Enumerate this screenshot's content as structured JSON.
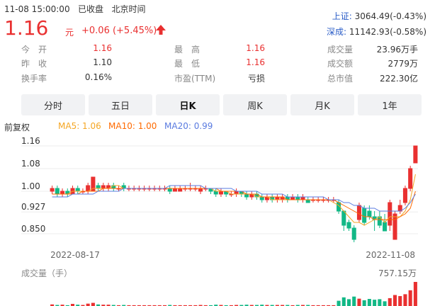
{
  "header": {
    "datetime": "11-08 15:00:00",
    "status": "已收盘",
    "timezone": "北京时间"
  },
  "quote": {
    "price": "1.16",
    "unit": "元",
    "change": "+0.06 (+5.45%)",
    "direction": "up"
  },
  "indices": [
    {
      "name": "上证:",
      "value": "3064.49(-0.43%)"
    },
    {
      "name": "深成:",
      "value": "11142.93(-0.58%)"
    }
  ],
  "stats": [
    {
      "label": "今　开",
      "value": "1.16",
      "red": true
    },
    {
      "label": "最　高",
      "value": "1.16",
      "red": true
    },
    {
      "label": "成交量",
      "value": "23.96万手",
      "red": false
    },
    {
      "label": "昨　收",
      "value": "1.10",
      "red": false
    },
    {
      "label": "最　低",
      "value": "1.16",
      "red": true
    },
    {
      "label": "成交额",
      "value": "2779万",
      "red": false
    },
    {
      "label": "换手率",
      "value": "0.16%",
      "red": false
    },
    {
      "label": "市盈(TTM)",
      "value": "亏损",
      "red": false
    },
    {
      "label": "总市值",
      "value": "222.30亿",
      "red": false
    }
  ],
  "tabs": [
    {
      "label": "分时",
      "active": false
    },
    {
      "label": "五日",
      "active": false
    },
    {
      "label": "日K",
      "active": true
    },
    {
      "label": "周K",
      "active": false
    },
    {
      "label": "月K",
      "active": false
    },
    {
      "label": "1年",
      "active": false
    }
  ],
  "ma_legend": {
    "adjust": "前复权",
    "ma5": "MA5: 1.06",
    "ma10": "MA10: 1.00",
    "ma20": "MA20: 0.99",
    "colors": {
      "ma5": "#f5a623",
      "ma10": "#ff6a00",
      "ma20": "#5a7be0"
    }
  },
  "colors": {
    "up": "#e93030",
    "down": "#12b886",
    "accent": "#2a5cc7"
  },
  "chart_data": {
    "type": "candlestick",
    "y_ticks": [
      "1.16",
      "1.08",
      "1.00",
      "0.927",
      "0.850"
    ],
    "y_tick_values": [
      1.16,
      1.08,
      1.0,
      0.927,
      0.85
    ],
    "x_labels": [
      "2022-08-17",
      "2022-11-08"
    ],
    "ylim": [
      0.8,
      1.19
    ],
    "candles": [
      [
        1.0,
        1.01,
        0.99,
        1.02
      ],
      [
        1.01,
        0.99,
        0.98,
        1.02
      ],
      [
        0.99,
        1.0,
        0.98,
        1.01
      ],
      [
        1.0,
        0.99,
        0.98,
        1.01
      ],
      [
        0.99,
        1.01,
        0.99,
        1.02
      ],
      [
        1.01,
        1.0,
        0.99,
        1.02
      ],
      [
        1.0,
        1.0,
        0.99,
        1.01
      ],
      [
        1.0,
        1.02,
        0.99,
        1.03
      ],
      [
        1.0,
        1.05,
        1.0,
        1.05
      ],
      [
        1.02,
        1.01,
        1.0,
        1.03
      ],
      [
        1.01,
        1.02,
        1.0,
        1.03
      ],
      [
        1.01,
        1.02,
        1.0,
        1.03
      ],
      [
        1.02,
        1.01,
        1.0,
        1.03
      ],
      [
        1.01,
        1.01,
        1.0,
        1.02
      ],
      [
        1.02,
        1.01,
        1.0,
        1.03
      ],
      [
        1.01,
        1.01,
        1.0,
        1.02
      ],
      [
        1.01,
        1.01,
        1.0,
        1.02
      ],
      [
        1.01,
        1.01,
        1.0,
        1.02
      ],
      [
        1.01,
        1.01,
        1.0,
        1.02
      ],
      [
        1.01,
        1.01,
        1.0,
        1.02
      ],
      [
        1.01,
        1.01,
        1.0,
        1.02
      ],
      [
        1.01,
        1.01,
        1.0,
        1.02
      ],
      [
        1.01,
        1.01,
        1.0,
        1.02
      ],
      [
        1.01,
        1.0,
        0.99,
        1.02
      ],
      [
        1.0,
        1.01,
        1.0,
        1.02
      ],
      [
        1.0,
        1.01,
        1.0,
        1.02
      ],
      [
        1.01,
        1.01,
        1.0,
        1.02
      ],
      [
        1.01,
        1.01,
        1.0,
        1.03
      ],
      [
        1.01,
        1.01,
        1.0,
        1.02
      ],
      [
        1.0,
        1.01,
        0.99,
        1.02
      ],
      [
        1.01,
        1.01,
        1.0,
        1.02
      ],
      [
        1.01,
        1.0,
        0.99,
        1.01
      ],
      [
        1.0,
        0.99,
        0.98,
        1.01
      ],
      [
        0.99,
        1.0,
        0.98,
        1.01
      ],
      [
        1.0,
        0.99,
        0.98,
        1.0
      ],
      [
        0.99,
        0.99,
        0.98,
        1.0
      ],
      [
        0.99,
        1.0,
        0.98,
        1.01
      ],
      [
        1.0,
        0.99,
        0.98,
        1.0
      ],
      [
        0.99,
        0.98,
        0.97,
        1.0
      ],
      [
        0.98,
        0.99,
        0.97,
        1.0
      ],
      [
        0.99,
        0.98,
        0.97,
        1.0
      ],
      [
        0.98,
        0.97,
        0.96,
        0.99
      ],
      [
        0.97,
        0.98,
        0.96,
        0.99
      ],
      [
        0.98,
        0.97,
        0.96,
        0.99
      ],
      [
        0.97,
        0.98,
        0.96,
        0.99
      ],
      [
        0.97,
        0.98,
        0.96,
        0.99
      ],
      [
        0.98,
        0.97,
        0.96,
        0.99
      ],
      [
        0.97,
        0.98,
        0.97,
        0.99
      ],
      [
        0.98,
        0.97,
        0.96,
        0.99
      ],
      [
        0.97,
        0.98,
        0.96,
        0.99
      ],
      [
        0.97,
        0.96,
        0.96,
        0.98
      ],
      [
        0.97,
        0.97,
        0.96,
        0.98
      ],
      [
        0.97,
        0.97,
        0.96,
        0.98
      ],
      [
        0.97,
        0.97,
        0.96,
        0.98
      ],
      [
        0.97,
        0.97,
        0.96,
        0.98
      ],
      [
        0.97,
        0.97,
        0.96,
        0.98
      ],
      [
        0.96,
        0.93,
        0.92,
        0.97
      ],
      [
        0.93,
        0.88,
        0.86,
        0.93
      ],
      [
        0.89,
        0.87,
        0.86,
        0.9
      ],
      [
        0.87,
        0.83,
        0.82,
        0.88
      ],
      [
        0.9,
        0.95,
        0.89,
        0.96
      ],
      [
        0.94,
        0.89,
        0.88,
        0.95
      ],
      [
        0.93,
        0.91,
        0.9,
        0.95
      ],
      [
        0.91,
        0.9,
        0.86,
        0.93
      ],
      [
        0.91,
        0.88,
        0.87,
        0.93
      ],
      [
        0.89,
        0.86,
        0.86,
        0.92
      ],
      [
        0.88,
        0.96,
        0.86,
        0.97
      ],
      [
        0.83,
        0.92,
        0.83,
        0.93
      ],
      [
        0.93,
        0.95,
        0.92,
        0.97
      ],
      [
        0.96,
        1.01,
        0.95,
        1.02
      ],
      [
        1.01,
        1.08,
        1.0,
        1.09
      ],
      [
        1.1,
        1.16,
        1.16,
        1.16
      ]
    ],
    "ma5": [
      0.99,
      0.99,
      0.99,
      0.99,
      1.0,
      1.0,
      1.0,
      1.0,
      1.01,
      1.01,
      1.01,
      1.01,
      1.02,
      1.02,
      1.01,
      1.01,
      1.01,
      1.01,
      1.01,
      1.01,
      1.01,
      1.01,
      1.01,
      1.01,
      1.01,
      1.01,
      1.01,
      1.01,
      1.01,
      1.01,
      1.01,
      1.01,
      1.0,
      1.0,
      1.0,
      0.99,
      0.99,
      0.99,
      0.99,
      0.99,
      0.98,
      0.98,
      0.98,
      0.97,
      0.97,
      0.97,
      0.97,
      0.97,
      0.97,
      0.97,
      0.97,
      0.97,
      0.97,
      0.97,
      0.97,
      0.96,
      0.95,
      0.93,
      0.91,
      0.89,
      0.89,
      0.88,
      0.89,
      0.9,
      0.91,
      0.89,
      0.91,
      0.91,
      0.91,
      0.93,
      0.97,
      1.06
    ],
    "ma10": [
      0.99,
      0.99,
      0.99,
      0.99,
      0.99,
      0.99,
      1.0,
      1.0,
      1.0,
      1.0,
      1.01,
      1.01,
      1.01,
      1.01,
      1.01,
      1.01,
      1.01,
      1.01,
      1.01,
      1.01,
      1.01,
      1.01,
      1.01,
      1.01,
      1.01,
      1.01,
      1.01,
      1.01,
      1.01,
      1.01,
      1.01,
      1.01,
      1.01,
      1.0,
      1.0,
      1.0,
      1.0,
      1.0,
      0.99,
      0.99,
      0.99,
      0.98,
      0.98,
      0.98,
      0.98,
      0.98,
      0.97,
      0.97,
      0.97,
      0.97,
      0.97,
      0.97,
      0.97,
      0.97,
      0.97,
      0.97,
      0.96,
      0.95,
      0.94,
      0.93,
      0.92,
      0.91,
      0.91,
      0.9,
      0.9,
      0.9,
      0.9,
      0.9,
      0.91,
      0.92,
      0.94,
      1.0
    ],
    "ma20": [
      0.98,
      0.98,
      0.98,
      0.98,
      0.99,
      0.99,
      0.99,
      0.99,
      0.99,
      1.0,
      1.0,
      1.0,
      1.0,
      1.0,
      1.01,
      1.01,
      1.01,
      1.01,
      1.01,
      1.01,
      1.01,
      1.01,
      1.01,
      1.02,
      1.02,
      1.02,
      1.02,
      1.02,
      1.02,
      1.02,
      1.01,
      1.01,
      1.01,
      1.01,
      1.01,
      1.01,
      1.0,
      1.0,
      1.0,
      1.0,
      1.0,
      0.99,
      0.99,
      0.99,
      0.99,
      0.99,
      0.98,
      0.98,
      0.98,
      0.98,
      0.98,
      0.98,
      0.98,
      0.98,
      0.97,
      0.97,
      0.97,
      0.96,
      0.96,
      0.95,
      0.95,
      0.94,
      0.94,
      0.94,
      0.93,
      0.93,
      0.93,
      0.93,
      0.93,
      0.94,
      0.96,
      0.99
    ],
    "volume_label": "成交量（手）",
    "volume_max_label": "757.15万",
    "volumes": [
      6,
      4,
      5,
      3,
      8,
      5,
      4,
      9,
      12,
      6,
      5,
      5,
      4,
      3,
      4,
      3,
      3,
      3,
      3,
      3,
      3,
      3,
      3,
      4,
      3,
      3,
      3,
      3,
      3,
      4,
      3,
      3,
      5,
      4,
      3,
      3,
      4,
      4,
      5,
      4,
      4,
      5,
      4,
      4,
      4,
      4,
      4,
      3,
      4,
      4,
      4,
      3,
      3,
      3,
      3,
      3,
      20,
      33,
      26,
      36,
      28,
      22,
      27,
      24,
      26,
      18,
      30,
      42,
      38,
      45,
      60,
      92
    ]
  }
}
